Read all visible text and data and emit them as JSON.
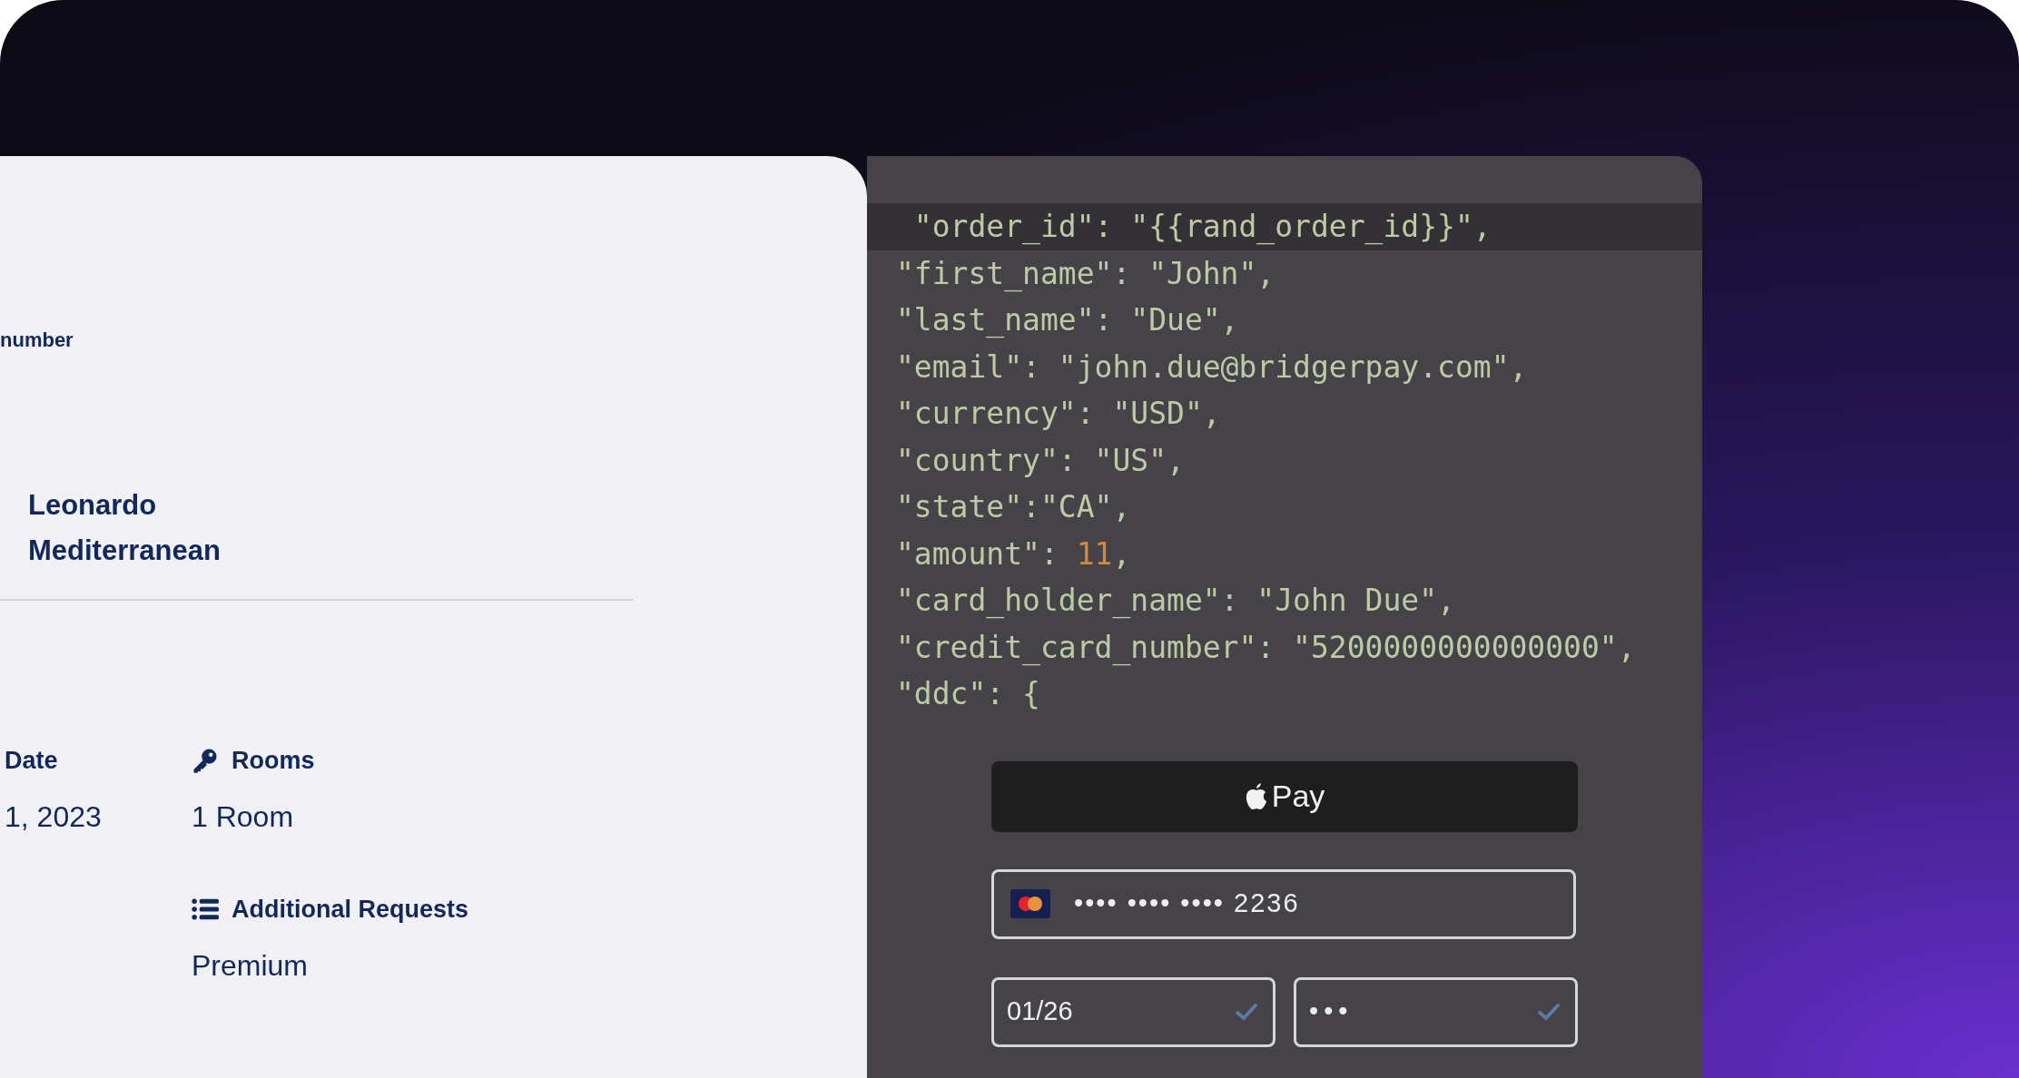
{
  "booking": {
    "truncated_label": "number",
    "hotel_name": [
      "Leonardo",
      "Mediterranean"
    ],
    "details": [
      [
        {
          "label": "Date",
          "value": "1, 2023"
        }
      ],
      [
        {
          "kind": "key",
          "label": "Rooms",
          "value": "1 Room"
        },
        {
          "kind": "list",
          "label": "Additional Requests",
          "value": "Premium"
        }
      ]
    ]
  },
  "code": {
    "lines": [
      {
        "highlighted": true,
        "parts": [
          {
            "kind": "text",
            "text": " \"order_id\": \"{{rand_order_id}}\","
          }
        ]
      },
      {
        "highlighted": false,
        "parts": [
          {
            "kind": "text",
            "text": "\"first_name\": \"John\","
          }
        ]
      },
      {
        "highlighted": false,
        "parts": [
          {
            "kind": "text",
            "text": "\"last_name\": \"Due\","
          }
        ]
      },
      {
        "highlighted": false,
        "parts": [
          {
            "kind": "text",
            "text": "\"email\": \"john.due@bridgerpay.com\","
          }
        ]
      },
      {
        "highlighted": false,
        "parts": [
          {
            "kind": "text",
            "text": "\"currency\": \"USD\","
          }
        ]
      },
      {
        "highlighted": false,
        "parts": [
          {
            "kind": "text",
            "text": "\"country\": \"US\","
          }
        ]
      },
      {
        "highlighted": false,
        "parts": [
          {
            "kind": "text",
            "text": "\"state\":\"CA\","
          }
        ]
      },
      {
        "highlighted": false,
        "parts": [
          {
            "kind": "text",
            "text": "\"amount\": "
          },
          {
            "kind": "number",
            "text": "11"
          },
          {
            "kind": "text",
            "text": ","
          }
        ]
      },
      {
        "highlighted": false,
        "parts": [
          {
            "kind": "text",
            "text": "\"card_holder_name\": \"John Due\","
          }
        ]
      },
      {
        "highlighted": false,
        "parts": [
          {
            "kind": "text",
            "text": "\"credit_card_number\": \"5200000000000000\","
          }
        ]
      },
      {
        "highlighted": false,
        "parts": [
          {
            "kind": "text",
            "text": "\"ddc\": {"
          }
        ]
      }
    ]
  },
  "payment": {
    "apple_pay_button": "Pay",
    "card_number": {
      "value": "•••• •••• •••• 2236"
    },
    "expiry": {
      "value": "01/26",
      "valid": true
    },
    "cvc": {
      "value": "•••",
      "valid": true
    }
  }
}
